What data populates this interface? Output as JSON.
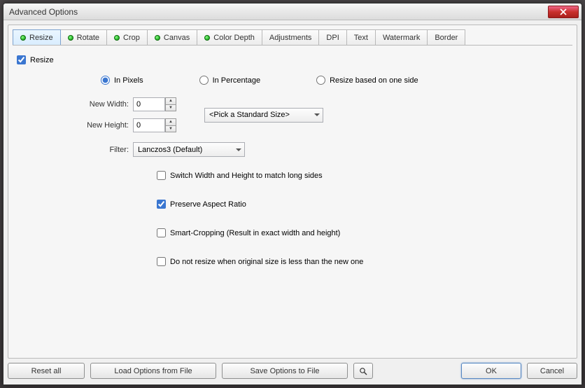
{
  "window": {
    "title": "Advanced Options"
  },
  "tabs": [
    {
      "label": "Resize",
      "dot": true,
      "active": true
    },
    {
      "label": "Rotate",
      "dot": true
    },
    {
      "label": "Crop",
      "dot": true
    },
    {
      "label": "Canvas",
      "dot": true
    },
    {
      "label": "Color Depth",
      "dot": true
    },
    {
      "label": "Adjustments",
      "dot": false
    },
    {
      "label": "DPI",
      "dot": false
    },
    {
      "label": "Text",
      "dot": false
    },
    {
      "label": "Watermark",
      "dot": false
    },
    {
      "label": "Border",
      "dot": false
    }
  ],
  "resize": {
    "enable_label": "Resize",
    "enable_checked": true,
    "mode": {
      "pixels": "In Pixels",
      "percentage": "In Percentage",
      "oneside": "Resize based on one side",
      "selected": "pixels"
    },
    "width_label": "New Width:",
    "width_value": "0",
    "height_label": "New Height:",
    "height_value": "0",
    "standard_size_label": "<Pick a Standard Size>",
    "filter_label": "Filter:",
    "filter_value": "Lanczos3 (Default)",
    "options": {
      "swap": {
        "label": "Switch Width and Height to match long sides",
        "checked": false
      },
      "aspect": {
        "label": "Preserve Aspect Ratio",
        "checked": true
      },
      "smartcrop": {
        "label": "Smart-Cropping (Result in exact width and height)",
        "checked": false
      },
      "noresize": {
        "label": "Do not resize when original size is less than the new one",
        "checked": false
      }
    }
  },
  "buttons": {
    "reset": "Reset all",
    "load": "Load Options from File",
    "save": "Save Options to File",
    "ok": "OK",
    "cancel": "Cancel"
  }
}
